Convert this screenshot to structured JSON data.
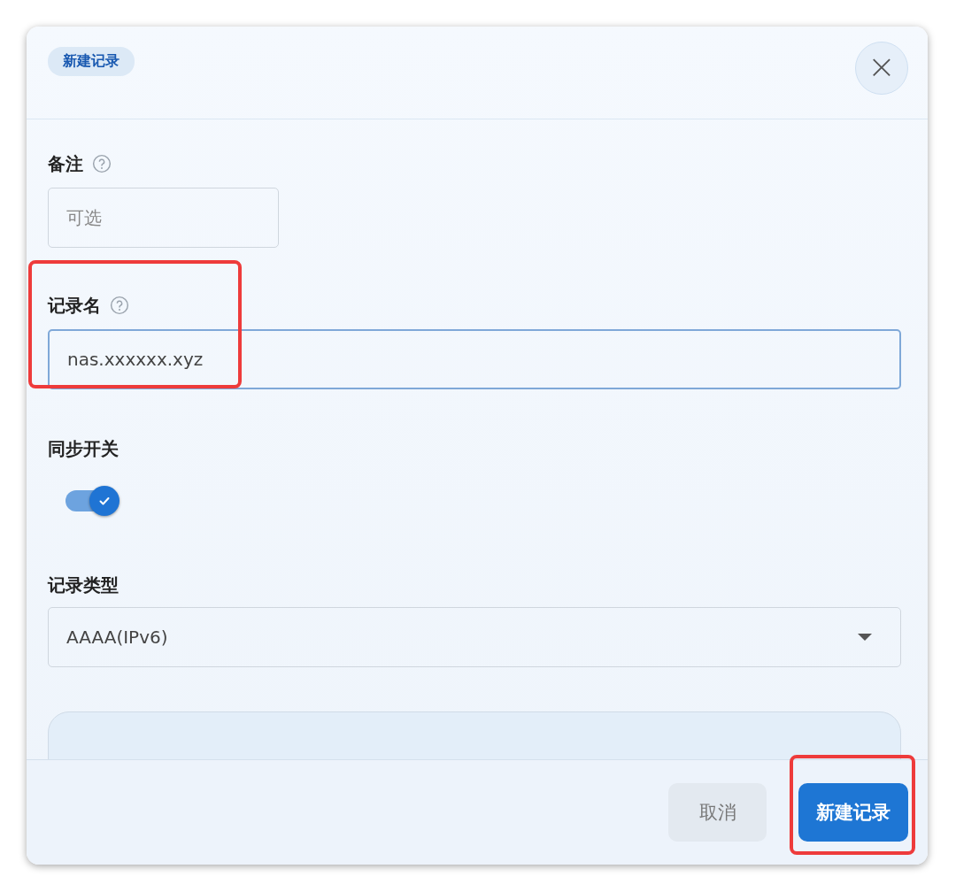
{
  "dialog": {
    "badge": "新建记录",
    "close_label": "×"
  },
  "fields": [
    {
      "kind": "text",
      "label": "备注",
      "help": true,
      "placeholder": "可选",
      "focused": false,
      "highlighted": false
    },
    {
      "kind": "text",
      "label": "记录名",
      "help": true,
      "value": "nas.xxxxxx.xyz",
      "focused": true,
      "highlighted": true
    },
    {
      "kind": "switch",
      "label": "同步开关",
      "on": true,
      "highlighted": false
    },
    {
      "kind": "select",
      "label": "记录类型",
      "value": "AAAA(IPv6)",
      "highlighted": false
    }
  ],
  "footer": {
    "buttons": [
      {
        "kind": "secondary",
        "label": "取消",
        "highlighted": false
      },
      {
        "kind": "primary",
        "label": "新建记录",
        "highlighted": true
      }
    ]
  }
}
